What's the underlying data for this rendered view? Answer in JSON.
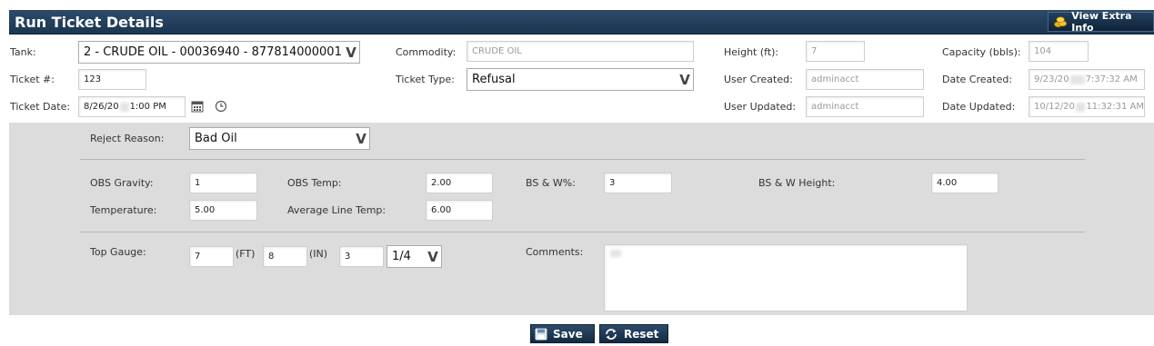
{
  "header": {
    "title": "Run Ticket Details",
    "extra_label": "View Extra Info"
  },
  "tank": {
    "label": "Tank:",
    "value": "2 - CRUDE OIL - 00036940 - 877814000001"
  },
  "commodity": {
    "label": "Commodity:",
    "value": "CRUDE OIL"
  },
  "height": {
    "label": "Height (ft):",
    "value": "7"
  },
  "capacity": {
    "label": "Capacity (bbls):",
    "value": "104"
  },
  "ticket_no": {
    "label": "Ticket #:",
    "value": "123"
  },
  "ticket_type": {
    "label": "Ticket Type:",
    "value": "Refusal"
  },
  "user_created": {
    "label": "User Created:",
    "value": "adminacct"
  },
  "date_created": {
    "label": "Date Created:",
    "value_a": "9/23/20",
    "value_b": "7:37:32 AM"
  },
  "ticket_date": {
    "label": "Ticket Date:",
    "value_a": "8/26/20",
    "value_b": "1:00 PM"
  },
  "user_updated": {
    "label": "User Updated:",
    "value": "adminacct"
  },
  "date_updated": {
    "label": "Date Updated:",
    "value_a": "10/12/20",
    "value_b": "11:32:31 AM"
  },
  "reject_reason": {
    "label": "Reject Reason:",
    "value": "Bad Oil"
  },
  "obs_gravity": {
    "label": "OBS Gravity:",
    "value": "1"
  },
  "obs_temp": {
    "label": "OBS Temp:",
    "value": "2.00"
  },
  "bsw_pct": {
    "label": "BS & W%:",
    "value": "3"
  },
  "bsw_height": {
    "label": "BS & W Height:",
    "value": "4.00"
  },
  "temperature": {
    "label": "Temperature:",
    "value": "5.00"
  },
  "avg_line_temp": {
    "label": "Average Line Temp:",
    "value": "6.00"
  },
  "top_gauge": {
    "label": "Top Gauge:",
    "ft": "7",
    "ft_unit": "(FT)",
    "in": "8",
    "in_unit": "(IN)",
    "num": "3",
    "frac": "1/4"
  },
  "comments": {
    "label": "Comments:",
    "value": ""
  },
  "buttons": {
    "save": "Save",
    "reset": "Reset"
  },
  "colors": {
    "header": "#1f3a57",
    "panel": "#dcdcdc",
    "button": "#1f3a57"
  },
  "icons": {
    "extra": "coins-icon",
    "calendar": "calendar-icon",
    "clock": "clock-icon",
    "save": "floppy-icon",
    "reset": "refresh-icon"
  }
}
